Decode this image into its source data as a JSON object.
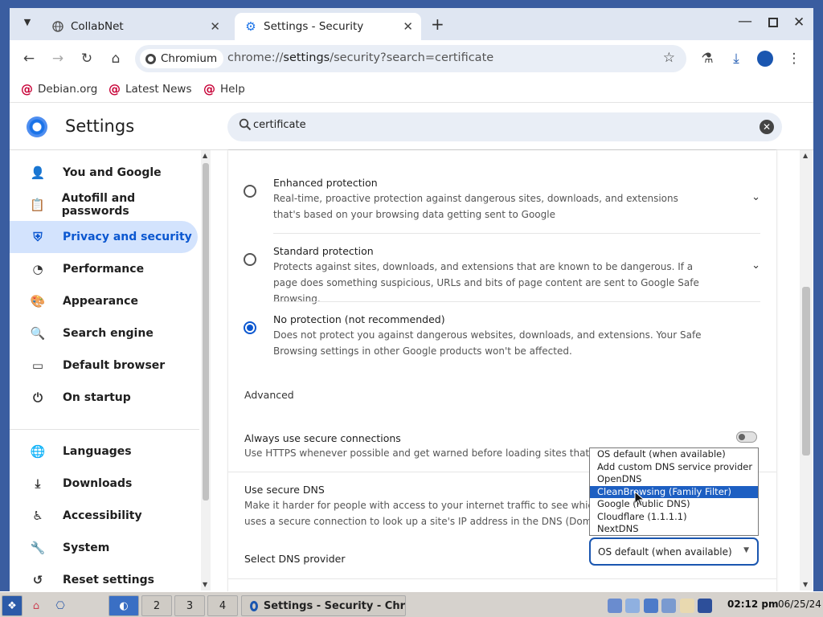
{
  "tabs": [
    {
      "label": "CollabNet"
    },
    {
      "label": "Settings - Security"
    }
  ],
  "toolbar": {
    "site_chip": "Chromium",
    "url_prefix": "chrome://",
    "url_host": "settings",
    "url_rest": "/security?search=certificate"
  },
  "bookmarks": [
    "Debian.org",
    "Latest News",
    "Help"
  ],
  "settings": {
    "title": "Settings",
    "search_value": "certificate",
    "nav": [
      {
        "label": "You and Google",
        "icon": "person-icon"
      },
      {
        "label": "Autofill and passwords",
        "icon": "clipboard-icon"
      },
      {
        "label": "Privacy and security",
        "icon": "shield-icon",
        "active": true
      },
      {
        "label": "Performance",
        "icon": "gauge-icon"
      },
      {
        "label": "Appearance",
        "icon": "palette-icon"
      },
      {
        "label": "Search engine",
        "icon": "search-icon"
      },
      {
        "label": "Default browser",
        "icon": "browser-icon"
      },
      {
        "label": "On startup",
        "icon": "power-icon"
      },
      {
        "label": "Languages",
        "icon": "globe-icon"
      },
      {
        "label": "Downloads",
        "icon": "download-icon"
      },
      {
        "label": "Accessibility",
        "icon": "accessibility-icon"
      },
      {
        "label": "System",
        "icon": "wrench-icon"
      },
      {
        "label": "Reset settings",
        "icon": "history-icon"
      }
    ],
    "protection": [
      {
        "title": "Enhanced protection",
        "desc": "Real-time, proactive protection against dangerous sites, downloads, and extensions that's based on your browsing data getting sent to Google",
        "selected": false
      },
      {
        "title": "Standard protection",
        "desc": "Protects against sites, downloads, and extensions that are known to be dangerous. If a page does something suspicious, URLs and bits of page content are sent to Google Safe Browsing.",
        "selected": false
      },
      {
        "title": "No protection (not recommended)",
        "desc": "Does not protect you against dangerous websites, downloads, and extensions. Your Safe Browsing settings in other Google products won't be affected.",
        "selected": true
      }
    ],
    "advanced_label": "Advanced",
    "secure_connections": {
      "title": "Always use secure connections",
      "desc": "Use HTTPS whenever possible and get warned before loading sites that don't support it",
      "enabled": false
    },
    "secure_dns": {
      "title": "Use secure DNS",
      "desc_line1": "Make it harder for people with access to your internet traffic to see which s",
      "desc_line2": "uses a secure connection to look up a site's IP address in the DNS (Domain"
    },
    "dns_provider": {
      "label": "Select DNS provider",
      "value": "OS default (when available)",
      "options": [
        "OS default (when available)",
        "Add custom DNS service provider",
        "OpenDNS",
        "CleanBrowsing (Family Filter)",
        "Google (Public DNS)",
        "Cloudflare (1.1.1.1)",
        "NextDNS"
      ],
      "highlighted": "CleanBrowsing (Family Filter)"
    }
  },
  "taskbar": {
    "workspaces": [
      "2",
      "3",
      "4"
    ],
    "active_window": "Settings - Security - Chr",
    "time": "02:12 pm",
    "date": "06/25/24"
  },
  "colors": {
    "accent": "#0b57d0",
    "highlight": "#1d5fc2",
    "desktop": "#3a5da0"
  }
}
